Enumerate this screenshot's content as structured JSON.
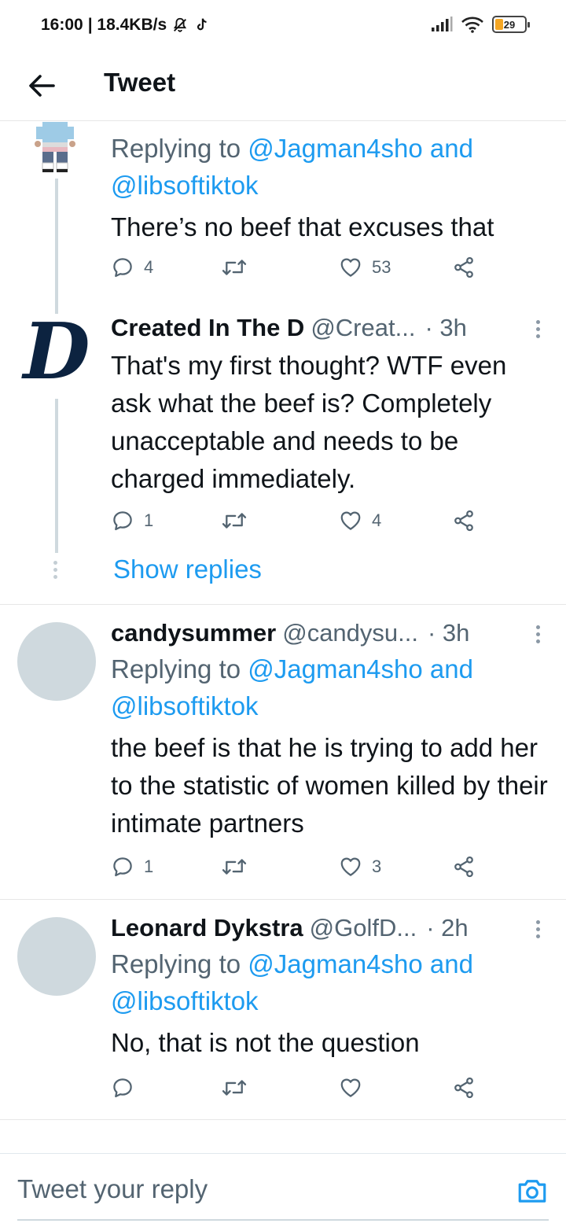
{
  "status_bar": {
    "time": "16:00",
    "speed": "| 18.4KB/s",
    "battery": "29"
  },
  "header": {
    "title": "Tweet",
    "back_icon": "arrow-left-icon"
  },
  "tweets": [
    {
      "replying_prefix": "Replying to ",
      "mentions": "@Jagman4sho and @libsoftiktok",
      "text": "There’s no beef that excuses that",
      "replies": "4",
      "retweets": "",
      "likes": "53"
    },
    {
      "name": "Created In The D",
      "handle": "@Creat...",
      "time": "· 3h",
      "text": "That's my first thought? WTF even ask what the beef is? Completely unacceptable and needs to be charged immediately.",
      "replies": "1",
      "retweets": "",
      "likes": "4"
    },
    {
      "name": "candysummer",
      "handle": "@candysu...",
      "time": "· 3h",
      "replying_prefix": "Replying to ",
      "mentions": "@Jagman4sho and @libsoftiktok",
      "text": "the beef is that he is trying to add her to the statistic of women killed by their intimate partners",
      "replies": "1",
      "retweets": "",
      "likes": "3"
    },
    {
      "name": "Leonard Dykstra",
      "handle": "@GolfD...",
      "time": "· 2h",
      "replying_prefix": "Replying to ",
      "mentions": "@Jagman4sho and @libsoftiktok",
      "text": "No, that is not the question",
      "replies": "",
      "retweets": "",
      "likes": ""
    }
  ],
  "show_replies": "Show replies",
  "composer": {
    "placeholder": "Tweet your reply",
    "camera_icon": "camera-icon"
  },
  "colors": {
    "accent": "#1d9bf0",
    "text": "#0f1419",
    "secondary": "#536471",
    "avatar_placeholder": "#cfd9de",
    "tigers_navy": "#0c2340"
  }
}
